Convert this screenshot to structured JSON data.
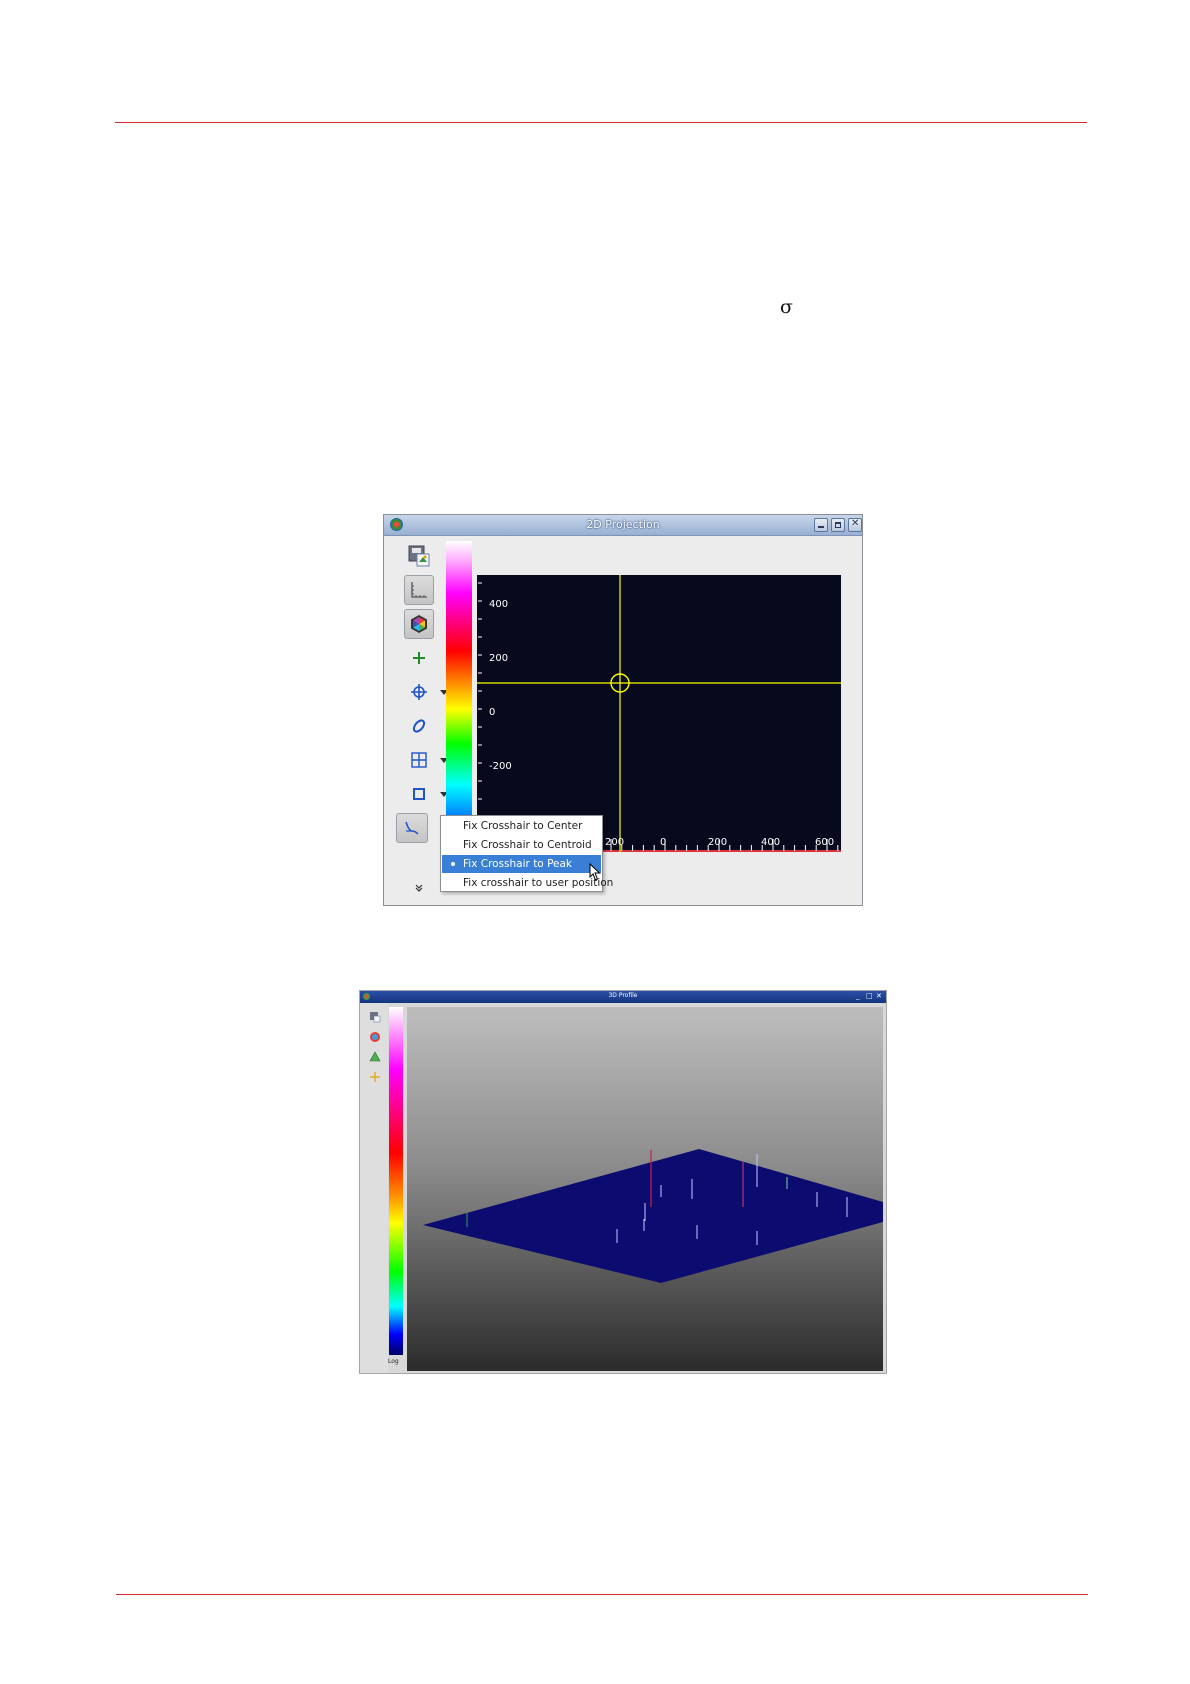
{
  "page": {
    "rule_color": "#d8262f",
    "accent": "#3a7fd6"
  },
  "text": {
    "sigma": "σ"
  },
  "window_2d": {
    "title": "2D Projection",
    "y_ticks": [
      "400",
      "200",
      "0",
      "-200"
    ],
    "x_ticks": [
      "200",
      "0",
      "200",
      "400",
      "600"
    ],
    "crosshair_color": "#ffff00",
    "tools": [
      "save-icon",
      "ruler-icon",
      "color-palette-icon",
      "add-icon",
      "crosshair-icon",
      "ellipse-icon",
      "grid-icon",
      "square-icon",
      "projection-icon",
      "expand-icon"
    ],
    "menu": {
      "items": [
        {
          "label": "Fix Crosshair to Center",
          "selected": false
        },
        {
          "label": "Fix Crosshair to Centroid",
          "selected": false
        },
        {
          "label": "Fix Crosshair to Peak",
          "selected": true
        },
        {
          "label": "Fix crosshair to user position",
          "selected": false
        }
      ]
    }
  },
  "window_3d": {
    "title": "3D Profile",
    "colorbar_label": "Log",
    "surface_color": "#0c0c70"
  }
}
